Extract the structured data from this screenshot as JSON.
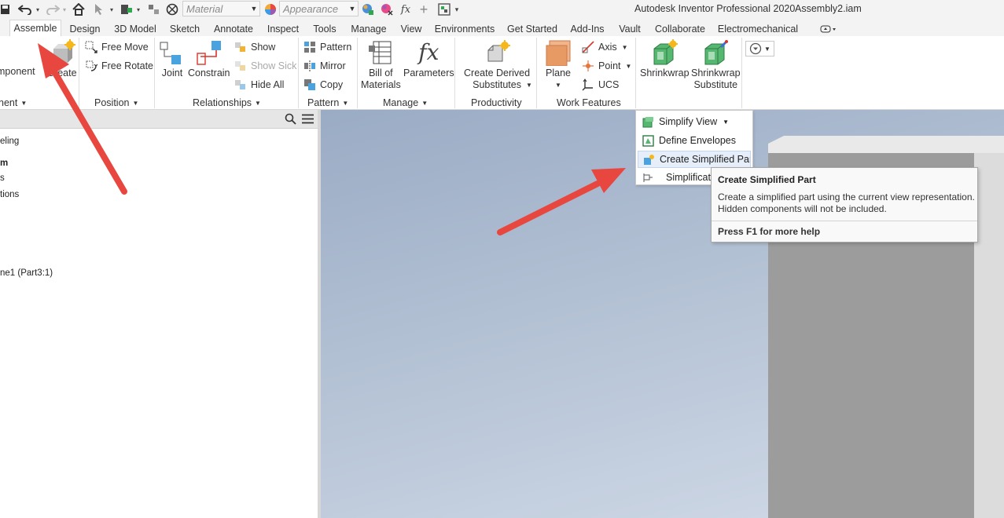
{
  "window": {
    "app_title": "Autodesk Inventor Professional 2020",
    "document": "Assembly2.iam"
  },
  "qat": {
    "material": {
      "placeholder": "Material"
    },
    "appearance": {
      "placeholder": "Appearance"
    },
    "fx_label": "fx"
  },
  "tabs": [
    {
      "label": "Assemble",
      "active": true
    },
    {
      "label": "Design"
    },
    {
      "label": "3D Model"
    },
    {
      "label": "Sketch"
    },
    {
      "label": "Annotate"
    },
    {
      "label": "Inspect"
    },
    {
      "label": "Tools"
    },
    {
      "label": "Manage"
    },
    {
      "label": "View"
    },
    {
      "label": "Environments"
    },
    {
      "label": "Get Started"
    },
    {
      "label": "Add-Ins"
    },
    {
      "label": "Vault"
    },
    {
      "label": "Collaborate"
    },
    {
      "label": "Electromechanical"
    }
  ],
  "ribbon": {
    "component": {
      "place_label": "mponent",
      "create_label": "Create",
      "panel": "nent"
    },
    "position": {
      "free_move": "Free Move",
      "free_rotate": "Free Rotate",
      "panel": "Position"
    },
    "relationships": {
      "joint": "Joint",
      "constrain": "Constrain",
      "show": "Show",
      "show_sick": "Show Sick",
      "hide_all": "Hide All",
      "panel": "Relationships"
    },
    "pattern": {
      "pattern": "Pattern",
      "mirror": "Mirror",
      "copy": "Copy",
      "panel": "Pattern"
    },
    "manage": {
      "bom_line1": "Bill of",
      "bom_line2": "Materials",
      "parameters": "Parameters",
      "parameters_glyph": "fx",
      "panel": "Manage"
    },
    "productivity": {
      "line1": "Create Derived",
      "line2": "Substitutes",
      "panel": "Productivity"
    },
    "work_features": {
      "plane": "Plane",
      "axis": "Axis",
      "point": "Point",
      "ucs": "UCS",
      "panel": "Work Features"
    },
    "simplification": {
      "shrinkwrap": "Shrinkwrap",
      "substitute_line1": "Shrinkwrap",
      "substitute_line2": "Substitute"
    }
  },
  "browser": {
    "rows": [
      "eling",
      "m",
      "s",
      "tions",
      "ne1 (Part3:1)"
    ]
  },
  "simplify_menu": {
    "items": [
      {
        "label": "Simplify View"
      },
      {
        "label": "Define Envelopes"
      },
      {
        "label": "Create Simplified Part"
      },
      {
        "label": "Simplificat"
      }
    ]
  },
  "tooltip": {
    "title": "Create Simplified Part",
    "line1": "Create a simplified part using the current view representation.",
    "line2": "Hidden components will not be included.",
    "help": "Press F1 for more help"
  },
  "colors": {
    "annotation_arrow": "#e8473f",
    "viewport_top": "#9aabc4",
    "viewport_bottom": "#d2dbe8"
  }
}
